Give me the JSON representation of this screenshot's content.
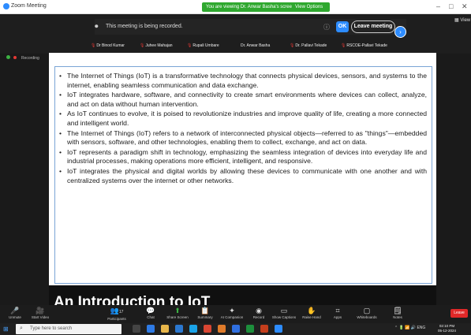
{
  "window": {
    "app_title": "Zoom Meeting",
    "viewing_label": "You are viewing Dr. Anwar Basha's screen",
    "view_options_label": "View Options",
    "view_label": "View",
    "minimize": "–",
    "maximize": "□",
    "close": "✕"
  },
  "recording_banner": {
    "text": "This meeting is being recorded.",
    "ok_label": "OK",
    "leave_label": "Leave meeting"
  },
  "participants": [
    "Dr Binod Kumar",
    "Juhee Mahajan",
    "Rupali Umbare",
    "Dr. Anwar Basha",
    "Dr. Pallavi Tekade",
    "RSCOE-Pallavi Tekade"
  ],
  "recording_status": "Recording",
  "slide": {
    "bullets": [
      "The Internet of Things (IoT) is a transformative technology that connects physical devices, sensors, and systems to the internet, enabling seamless communication and data exchange.",
      "IoT integrates hardware, software, and connectivity to create smart environments where devices can collect, analyze, and act on data without human intervention.",
      "As IoT continues to evolve, it is poised to revolutionize industries and improve quality of life, creating a more connected and intelligent world.",
      "The Internet of Things (IoT) refers to a network of interconnected physical objects—referred to as \"things\"—embedded with sensors, software, and other technologies, enabling them to collect, exchange, and act on data.",
      "IoT represents a paradigm shift in technology, emphasizing the seamless integration of devices into everyday life and industrial processes, making operations more efficient, intelligent, and responsive.",
      "IoT integrates the physical and digital worlds by allowing these devices to communicate with one another and with centralized systems over the internet or other networks."
    ],
    "title_partial": "An Introduction to IoT"
  },
  "toolbar": {
    "items": [
      {
        "label": "Unmute",
        "icon": "microphone-icon"
      },
      {
        "label": "Start Video",
        "icon": "video-icon"
      },
      {
        "label": "Participants",
        "icon": "participants-icon",
        "count": "17"
      },
      {
        "label": "Chat",
        "icon": "chat-icon"
      },
      {
        "label": "Share Screen",
        "icon": "share-screen-icon"
      },
      {
        "label": "Summary",
        "icon": "summary-icon"
      },
      {
        "label": "AI Companion",
        "icon": "ai-companion-icon"
      },
      {
        "label": "Record",
        "icon": "record-icon"
      },
      {
        "label": "Show Captions",
        "icon": "captions-icon"
      },
      {
        "label": "Raise Hand",
        "icon": "raise-hand-icon"
      },
      {
        "label": "Apps",
        "icon": "apps-icon"
      },
      {
        "label": "Whiteboards",
        "icon": "whiteboard-icon"
      },
      {
        "label": "Notes",
        "icon": "notes-icon"
      }
    ],
    "leave_label": "Leave"
  },
  "taskbar": {
    "search_placeholder": "Type here to search",
    "time": "02:10 PM",
    "date": "05-12-2024",
    "tray_lang": "ENG"
  }
}
